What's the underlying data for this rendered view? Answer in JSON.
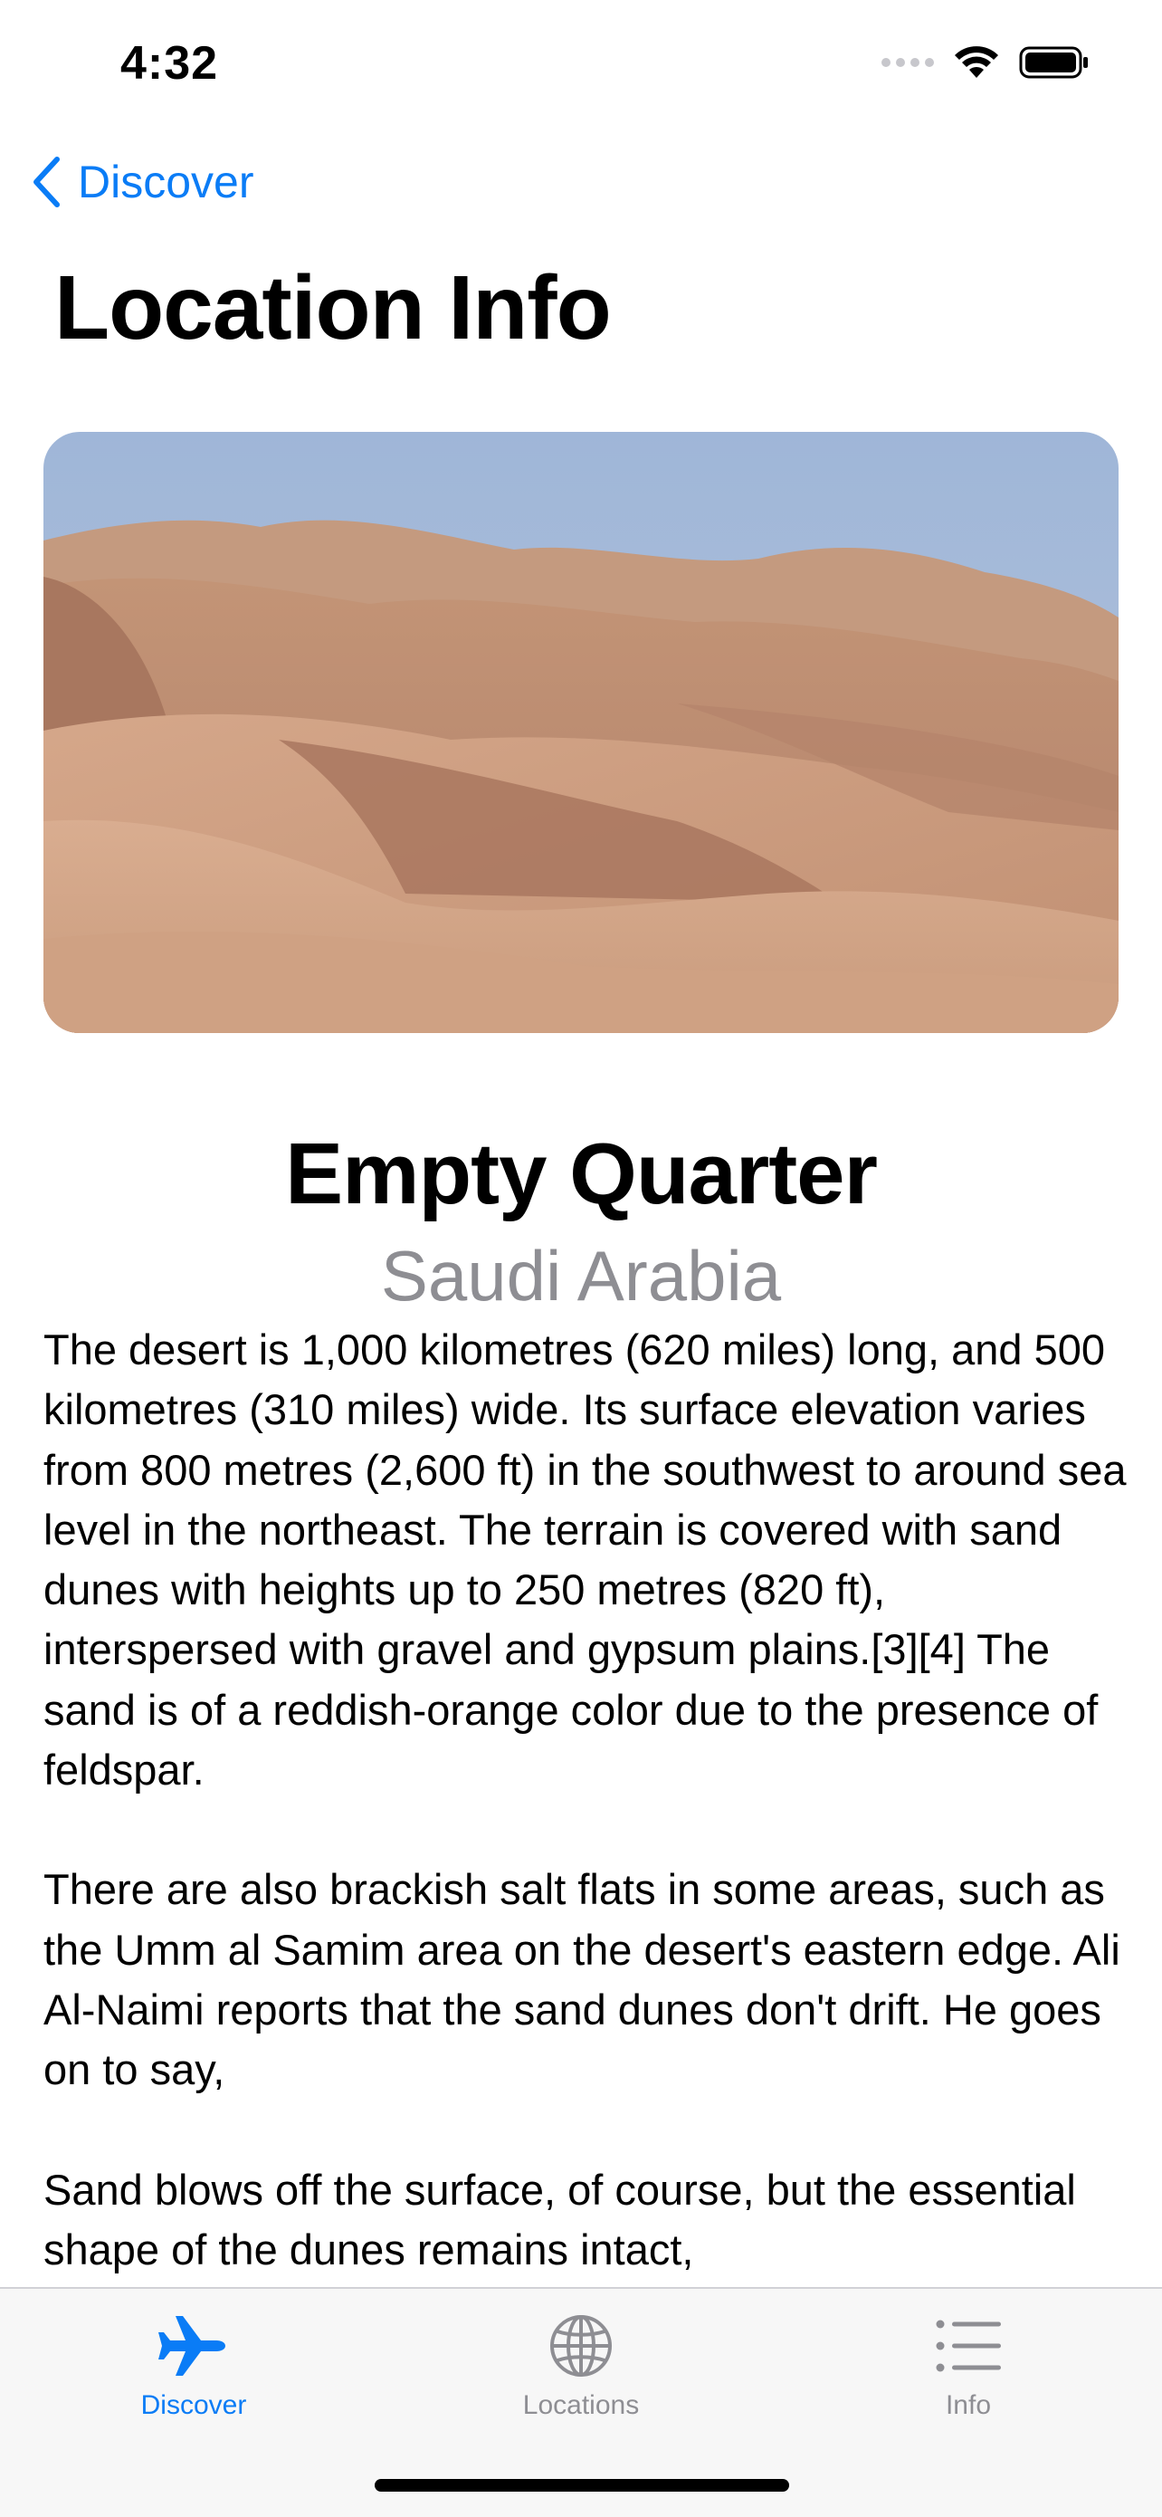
{
  "status_bar": {
    "time": "4:32"
  },
  "nav": {
    "back_label": "Discover",
    "title": "Location Info"
  },
  "location": {
    "name": "Empty Quarter",
    "country": "Saudi Arabia",
    "description": [
      "The desert is 1,000 kilometres (620 miles) long, and 500 kilometres (310 miles) wide. Its surface elevation varies from 800 metres (2,600 ft) in the southwest to around sea level in the northeast. The terrain is covered with sand dunes with heights up to 250 metres (820 ft), interspersed with gravel and gypsum plains.[3][4] The sand is of a reddish-orange color due to the presence of feldspar.",
      "There are also brackish salt flats in some areas, such as the Umm al Samim area on the desert's eastern edge. Ali Al-Naimi reports that the sand dunes don't drift. He goes on to say,",
      "Sand blows off the surface, of course, but the essential shape of the dunes remains intact,"
    ]
  },
  "tab_bar": {
    "tabs": [
      {
        "label": "Discover",
        "icon": "airplane-icon",
        "active": true
      },
      {
        "label": "Locations",
        "icon": "globe-icon",
        "active": false
      },
      {
        "label": "Info",
        "icon": "list-icon",
        "active": false
      }
    ]
  },
  "colors": {
    "accent": "#0a7cf6",
    "secondary_text": "#8e8e93",
    "tab_bar_background": "#f7f7f7"
  }
}
